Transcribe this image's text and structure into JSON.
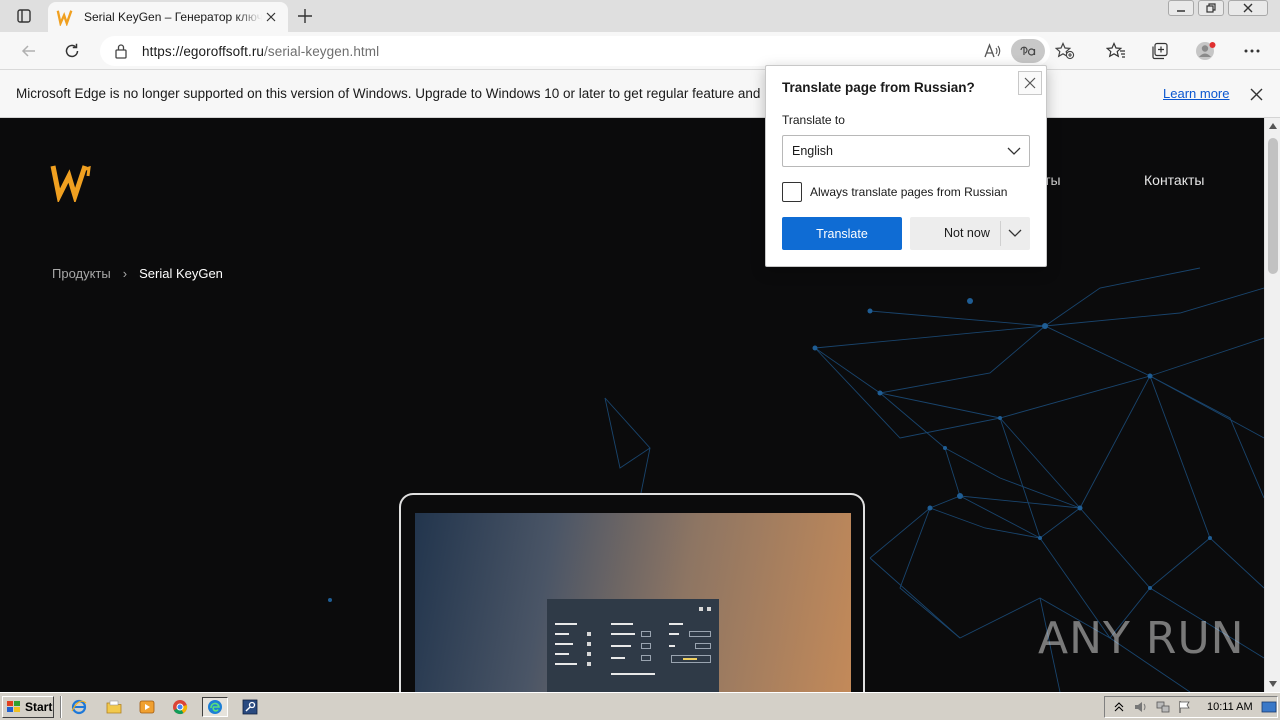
{
  "browser": {
    "tab": {
      "title": "Serial KeyGen – Генератор ключей"
    },
    "address": {
      "host": "https://egoroffsoft.ru",
      "path": "/serial-keygen.html"
    },
    "infobar": {
      "message": "Microsoft Edge is no longer supported on this version of Windows. Upgrade to Windows 10 or later to get regular feature and",
      "learn_more": "Learn more"
    }
  },
  "page": {
    "nav": {
      "partial": "акты",
      "contacts": "Контакты"
    },
    "breadcrumb": {
      "parent": "Продукты",
      "separator": "›",
      "current": "Serial KeyGen"
    },
    "accent_color": "#f0a020"
  },
  "translate_popup": {
    "title": "Translate page from Russian?",
    "translate_to_label": "Translate to",
    "selected_language": "English",
    "always_label": "Always translate pages from Russian",
    "translate_button": "Translate",
    "not_now_button": "Not now"
  },
  "watermark": {
    "text": "ANY RUN"
  },
  "taskbar": {
    "start_label": "Start",
    "clock": "10:11 AM"
  }
}
